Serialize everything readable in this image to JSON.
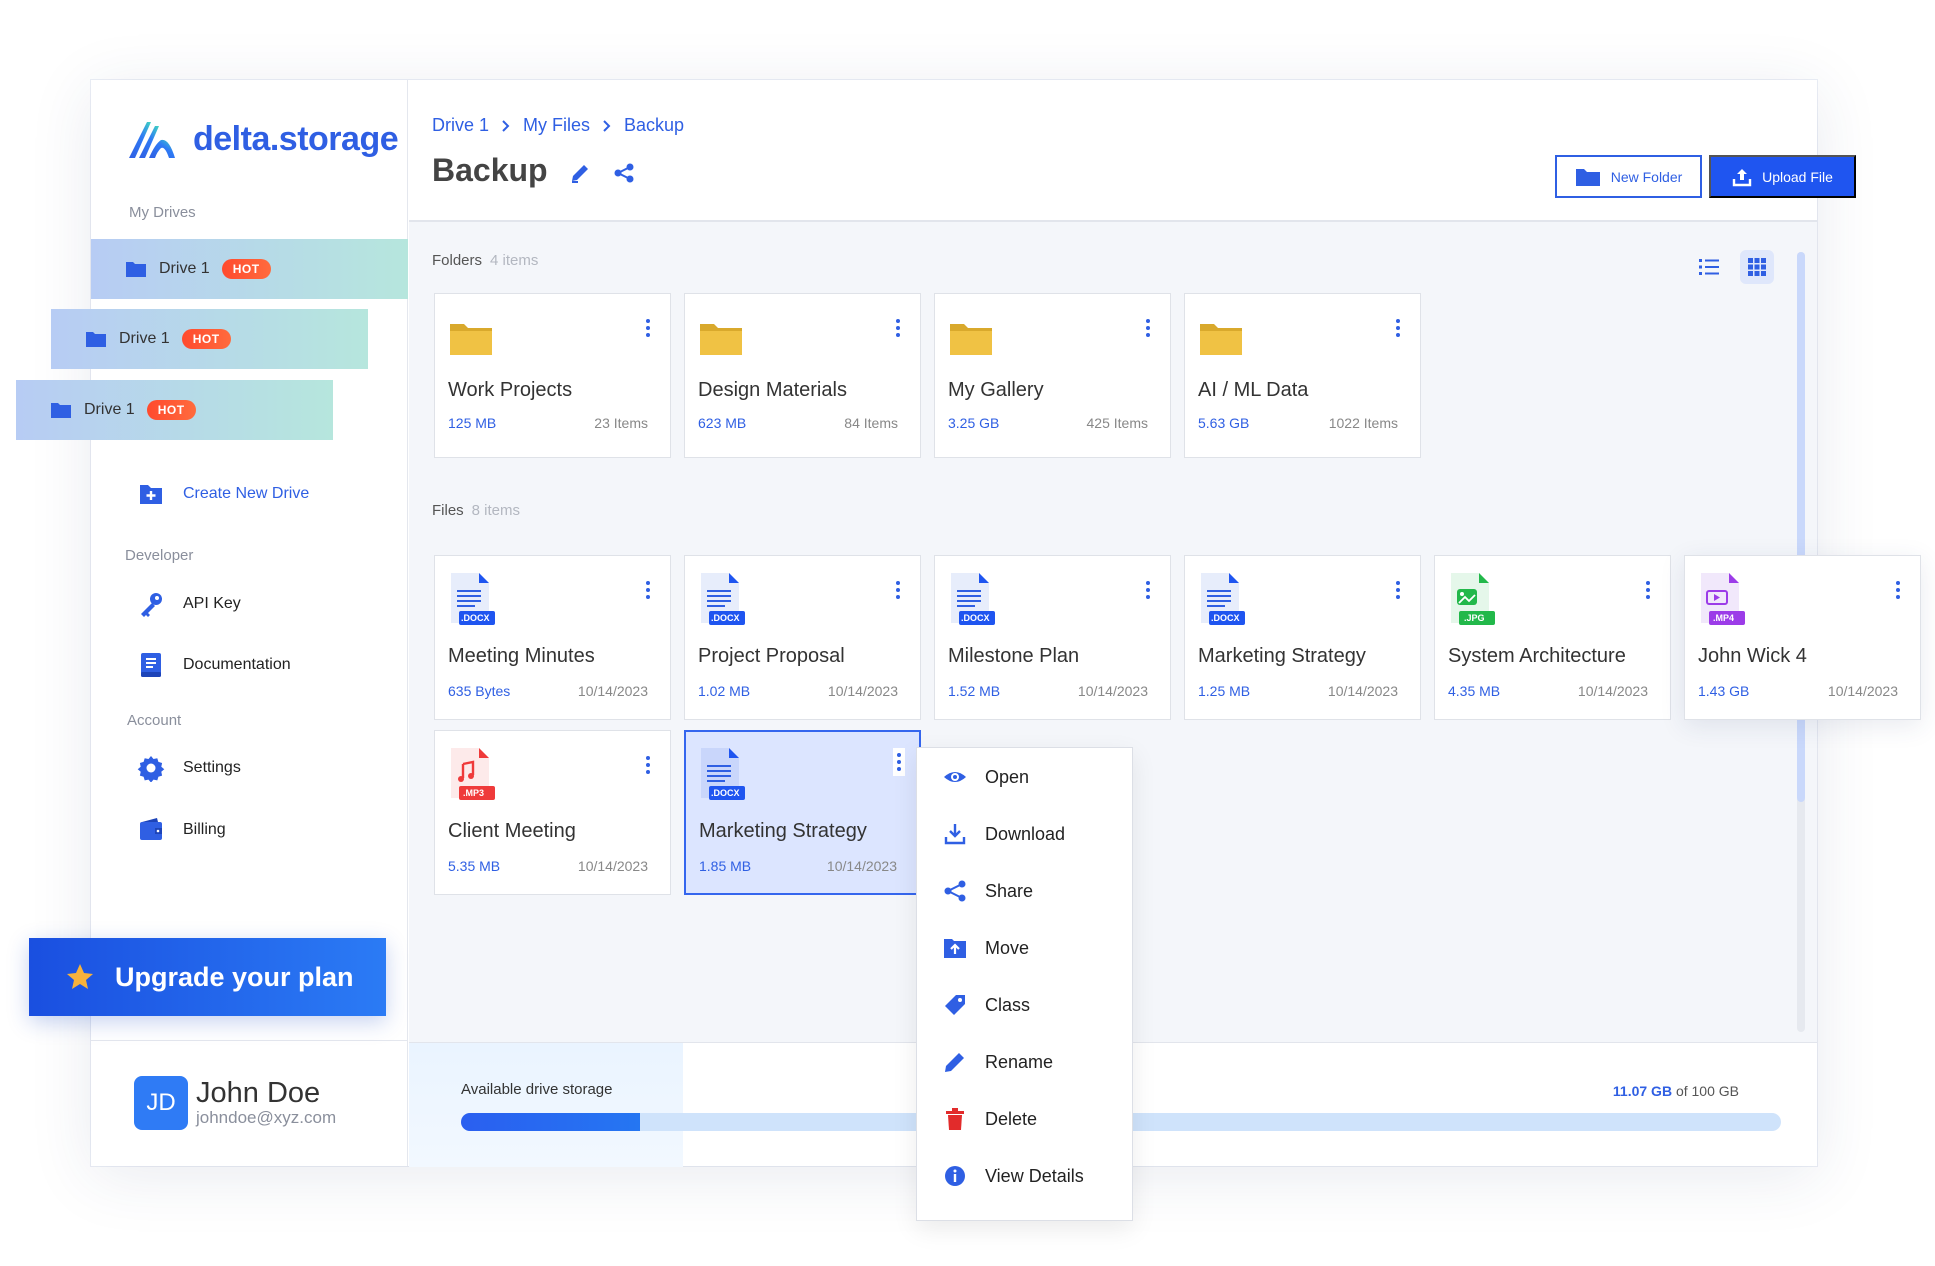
{
  "brand": {
    "logo_text": "delta.storage"
  },
  "sidebar": {
    "my_drives_label": "My Drives",
    "drives": [
      {
        "label": "Drive 1",
        "badge": "HOT"
      },
      {
        "label": "Drive 1",
        "badge": "HOT"
      },
      {
        "label": "Drive 1",
        "badge": "HOT"
      }
    ],
    "create_drive_label": "Create New Drive",
    "developer_label": "Developer",
    "api_key_label": "API Key",
    "documentation_label": "Documentation",
    "account_label": "Account",
    "settings_label": "Settings",
    "billing_label": "Billing",
    "upgrade_label": "Upgrade your plan"
  },
  "user": {
    "initials": "JD",
    "name": "John Doe",
    "email": "johndoe@xyz.com"
  },
  "header": {
    "breadcrumb": [
      "Drive 1",
      "My Files",
      "Backup"
    ],
    "title": "Backup",
    "new_folder_label": "New Folder",
    "upload_label": "Upload File"
  },
  "folders": {
    "label": "Folders",
    "count": "4 items",
    "items": [
      {
        "name": "Work Projects",
        "size": "125 MB",
        "items": "23 Items"
      },
      {
        "name": "Design Materials",
        "size": "623 MB",
        "items": "84 Items"
      },
      {
        "name": "My Gallery",
        "size": "3.25 GB",
        "items": "425 Items"
      },
      {
        "name": "AI / ML Data",
        "size": "5.63 GB",
        "items": "1022 Items"
      }
    ]
  },
  "files": {
    "label": "Files",
    "count": "8 items",
    "items": [
      {
        "name": "Meeting Minutes",
        "size": "635 Bytes",
        "date": "10/14/2023",
        "ext": ".DOCX",
        "icon": "docx-file-icon"
      },
      {
        "name": "Project Proposal",
        "size": "1.02 MB",
        "date": "10/14/2023",
        "ext": ".DOCX",
        "icon": "docx-file-icon"
      },
      {
        "name": "Milestone Plan",
        "size": "1.52 MB",
        "date": "10/14/2023",
        "ext": ".DOCX",
        "icon": "docx-file-icon"
      },
      {
        "name": "Marketing Strategy",
        "size": "1.25 MB",
        "date": "10/14/2023",
        "ext": ".DOCX",
        "icon": "docx-file-icon"
      },
      {
        "name": "System Architecture",
        "size": "4.35 MB",
        "date": "10/14/2023",
        "ext": ".JPG",
        "icon": "jpg-file-icon"
      },
      {
        "name": "John Wick 4",
        "size": "1.43 GB",
        "date": "10/14/2023",
        "ext": ".MP4",
        "icon": "mp4-file-icon"
      },
      {
        "name": "Client Meeting",
        "size": "5.35 MB",
        "date": "10/14/2023",
        "ext": ".MP3",
        "icon": "mp3-file-icon"
      },
      {
        "name": "Marketing Strategy",
        "size": "1.85 MB",
        "date": "10/14/2023",
        "ext": ".DOCX",
        "icon": "docx-file-icon"
      }
    ]
  },
  "context_menu": {
    "items": [
      "Open",
      "Download",
      "Share",
      "Move",
      "Class",
      "Rename",
      "Delete",
      "View Details"
    ]
  },
  "storage": {
    "label": "Available drive storage",
    "used": "11.07 GB",
    "total_text": "of 100 GB",
    "used_fraction": 0.1107
  },
  "colors": {
    "accent": "#2f5fe3",
    "hot": "#ff4a2e",
    "selected_bg": "#dce5ff"
  }
}
